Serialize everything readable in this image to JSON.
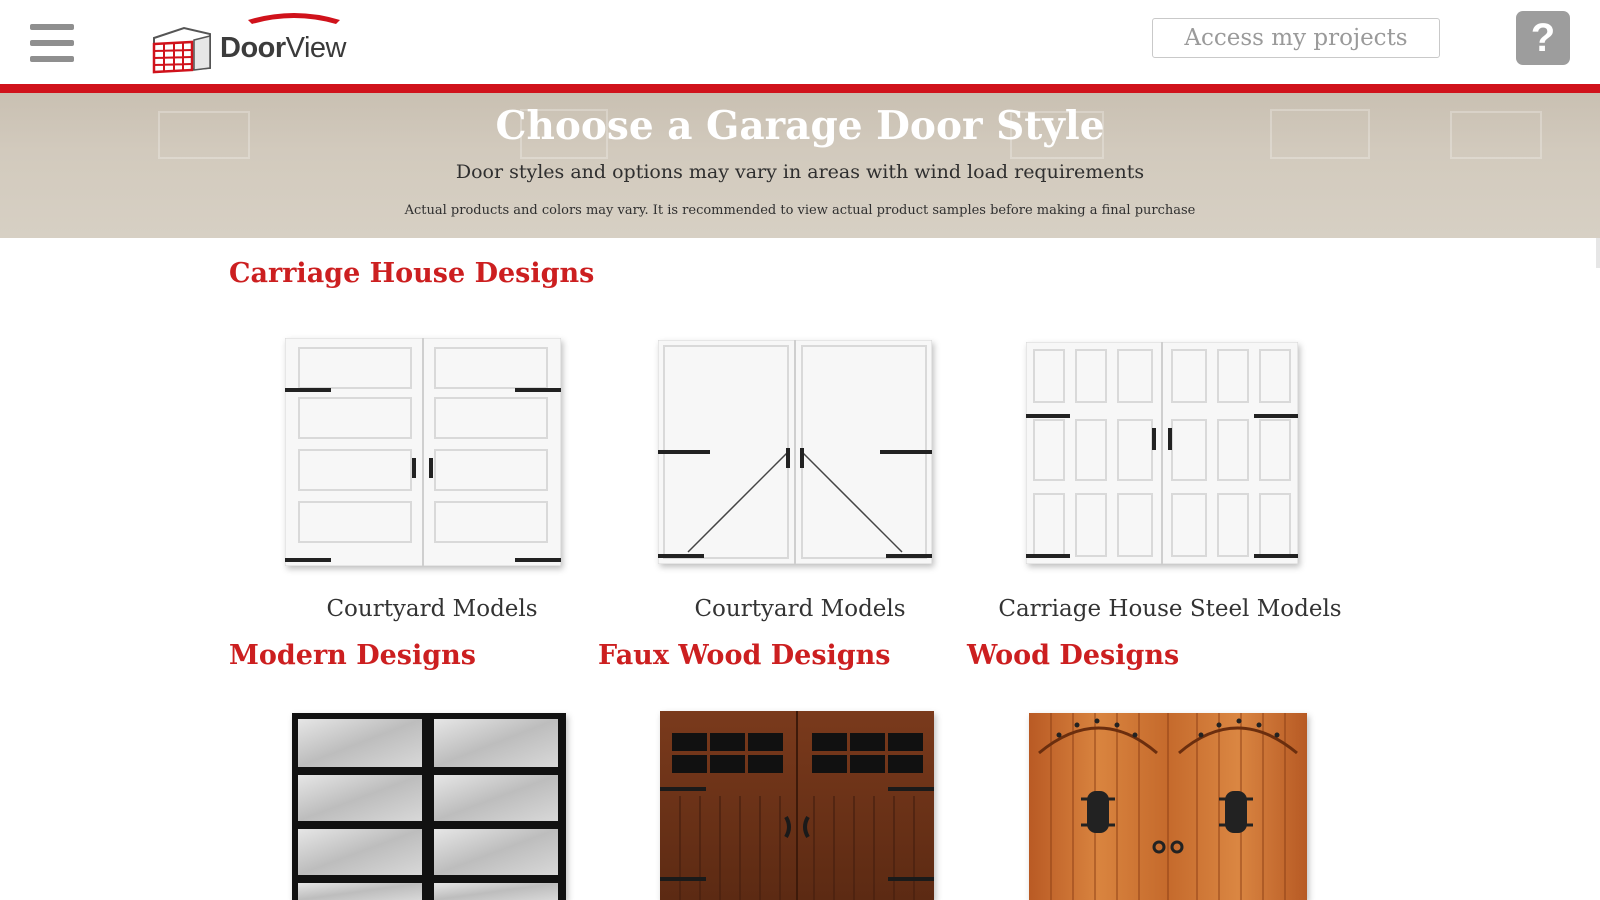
{
  "header": {
    "menu_icon": "hamburger-menu-icon",
    "logo": {
      "brand_bold": "Door",
      "brand_light": "View",
      "ribbon_text": ""
    },
    "access_button_label": "Access my projects",
    "help_button_label": "?",
    "accent_color": "#d0121b"
  },
  "banner": {
    "title": "Choose a Garage Door Style",
    "subtitle": "Door styles and options may vary in areas with wind load requirements",
    "note": "Actual products and colors may vary. It is recommended to view actual product samples before making a final purchase"
  },
  "sections": {
    "carriage_house": {
      "heading": "Carriage House Designs",
      "items": [
        {
          "caption": "Courtyard Models",
          "image": "white-carriage-door-horizontal-panels"
        },
        {
          "caption": "Courtyard Models",
          "image": "white-carriage-door-x-brace"
        },
        {
          "caption": "Carriage House Steel Models",
          "image": "white-carriage-door-grid-panels"
        }
      ]
    },
    "modern": {
      "heading": "Modern Designs",
      "image": "black-frame-glass-door"
    },
    "faux_wood": {
      "heading": "Faux Wood Designs",
      "image": "brown-faux-wood-door-windows"
    },
    "wood": {
      "heading": "Wood Designs",
      "image": "cedar-arched-wood-door"
    }
  },
  "colors": {
    "heading_red": "#cc1f20",
    "banner_bg": "#d2cabd"
  }
}
